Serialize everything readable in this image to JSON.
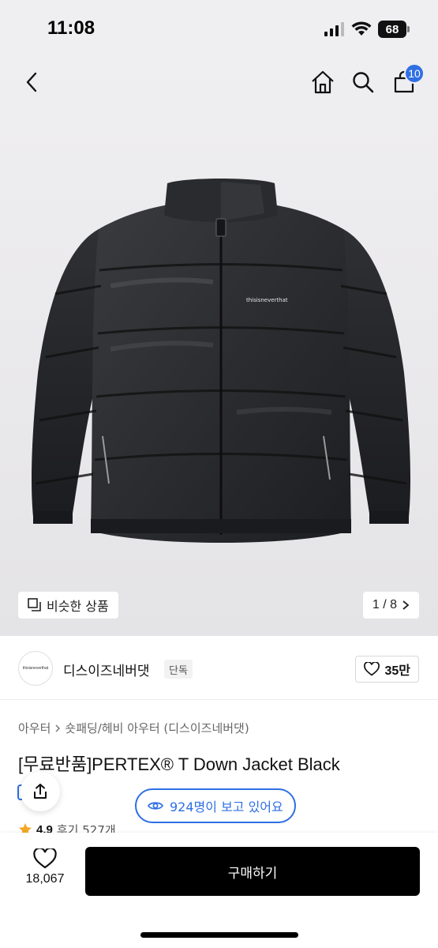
{
  "status_bar": {
    "time": "11:08",
    "battery": "68"
  },
  "nav": {
    "cart_count": "10"
  },
  "gallery": {
    "similar_label": "비슷한 상품",
    "page_indicator": "1 / 8",
    "jacket_logo_text": "thisisneverthat"
  },
  "brand": {
    "logo_text": "thisisneverthat",
    "name": "디스이즈네버댓",
    "tag": "단독",
    "likes": "35만"
  },
  "breadcrumb": {
    "items": [
      "아우터",
      "숏패딩/헤비 아우터 (디스이즈네버댓)"
    ]
  },
  "product": {
    "title": "[무료반품]PERTEX® T Down Jacket Black"
  },
  "viewers": {
    "label": "924명이 보고 있어요"
  },
  "rating": {
    "score": "4.9",
    "reviews": "후기 527개"
  },
  "bottom": {
    "fav_count": "18,067",
    "buy_label": "구매하기"
  },
  "colors": {
    "accent": "#2f6fe4",
    "buy_bg": "#000000",
    "hero_bg": "#efeef0"
  }
}
